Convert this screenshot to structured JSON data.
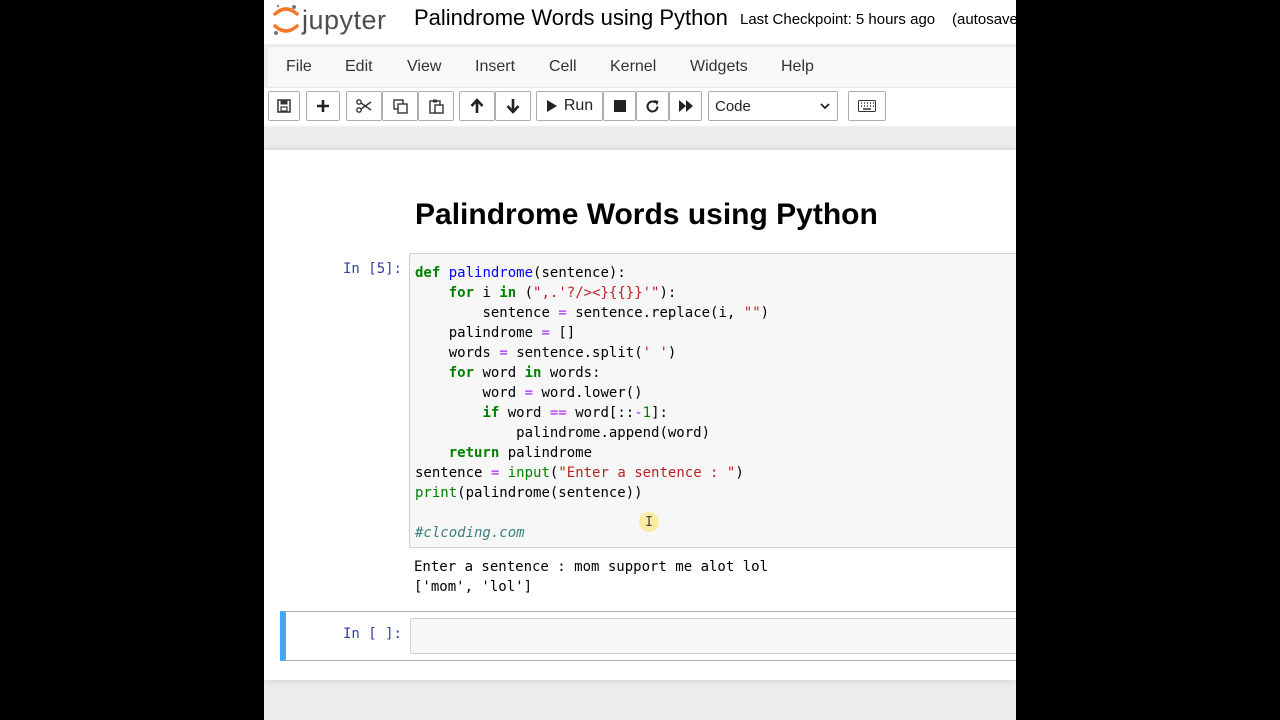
{
  "header": {
    "logo_text": "jupyter",
    "notebook_title": "Palindrome Words using Python",
    "checkpoint": "Last Checkpoint: 5 hours ago",
    "autosave": "(autosaved)"
  },
  "menu": [
    "File",
    "Edit",
    "View",
    "Insert",
    "Cell",
    "Kernel",
    "Widgets",
    "Help"
  ],
  "toolbar": {
    "run_label": "Run",
    "cell_type": "Code"
  },
  "notebook": {
    "heading": "Palindrome Words using Python",
    "code_cell": {
      "prompt": "In [5]:",
      "code": [
        "def palindrome(sentence):",
        "    for i in (\",.'?/><}{{}}'\"):",
        "        sentence = sentence.replace(i, \"\")",
        "    palindrome = []",
        "    words = sentence.split(' ')",
        "    for word in words:",
        "        word = word.lower()",
        "        if word == word[::-1]:",
        "            palindrome.append(word)",
        "    return palindrome",
        "sentence = input(\"Enter a sentence : \")",
        "print(palindrome(sentence))",
        "",
        "#clcoding.com"
      ],
      "output": [
        "Enter a sentence : mom support me alot lol",
        "['mom', 'lol']"
      ]
    },
    "empty_cell": {
      "prompt": "In [ ]:"
    }
  },
  "colors": {
    "prompt": "#303f9f",
    "keyword": "#008000",
    "function_name": "#0000ff",
    "operator": "#aa22ff",
    "string": "#ba2121",
    "comment": "#408080",
    "selected_cell_bar": "#42a5f5"
  }
}
